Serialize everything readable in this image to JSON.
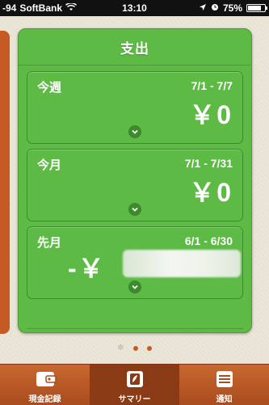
{
  "status_bar": {
    "signal": "-94",
    "carrier": "SoftBank",
    "time": "13:10",
    "battery_percent": "75%"
  },
  "panel": {
    "title": "支出"
  },
  "cards": [
    {
      "label": "今週",
      "range": "7/1 - 7/7",
      "amount": "￥0"
    },
    {
      "label": "今月",
      "range": "7/1 - 7/31",
      "amount": "￥0"
    },
    {
      "label": "先月",
      "range": "6/1 - 6/30",
      "amount_prefix": "-￥"
    }
  ],
  "page_dots": {
    "count": 3,
    "current": 0
  },
  "tabbar": {
    "tabs": [
      {
        "label": "現金記録",
        "icon": "wallet-icon",
        "active": false
      },
      {
        "label": "サマリー",
        "icon": "summary-icon",
        "active": true
      },
      {
        "label": "通知",
        "icon": "list-icon",
        "active": false
      }
    ]
  },
  "colors": {
    "panel_green": "#5cba45",
    "tabbar_orange": "#c8672f",
    "dot_orange": "#c55a28"
  }
}
